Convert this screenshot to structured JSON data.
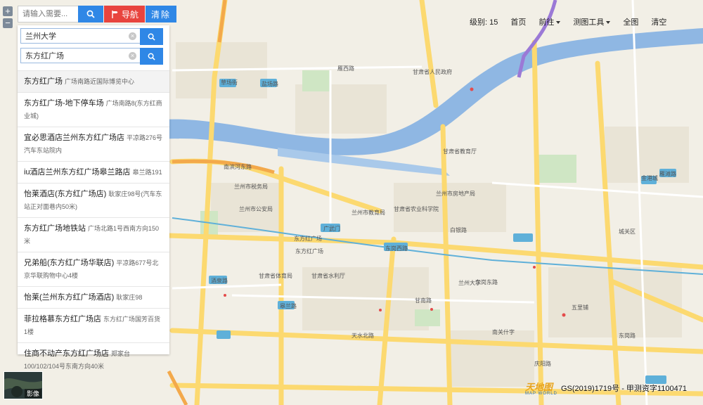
{
  "search": {
    "placeholder": "请输入需要...",
    "nav_label": "导航",
    "clear_label": "清除"
  },
  "route": {
    "from": "兰州大学",
    "to": "东方红广场",
    "clear_glyph": "×"
  },
  "results": [
    {
      "name": "东方红广场",
      "addr": "广场南路近国际博览中心"
    },
    {
      "name": "东方红广场-地下停车场",
      "addr": "广场南路8(东方红商业城)"
    },
    {
      "name": "宜必思酒店兰州东方红广场店",
      "addr": "平凉路276号汽车东站院内"
    },
    {
      "name": "iu酒店兰州东方红广场皋兰路店",
      "addr": "皋兰路191"
    },
    {
      "name": "怡莱酒店(东方红广场店)",
      "addr": "耿家庄98号(汽车东站正对面巷内50米)"
    },
    {
      "name": "东方红广场地铁站",
      "addr": "广场北路1号西南方向150米"
    },
    {
      "name": "兄弟船(东方红广场华联店)",
      "addr": "平凉路677号北京华联购物中心4楼"
    },
    {
      "name": "怡莱(兰州东方红广场酒店)",
      "addr": "耿家庄98"
    },
    {
      "name": "菲拉格慕东方红广场店",
      "addr": "东方红广场国芳百货1楼"
    },
    {
      "name": "住商不动产东方红广场店",
      "addr": "郑家台100/102/104号东南方向40米"
    }
  ],
  "toolbar": {
    "level": "级别: 15",
    "home": "首页",
    "forward": "前往",
    "measure": "测图工具",
    "fullscreen": "全图",
    "clear": "清空"
  },
  "zoom": {
    "in": "+",
    "out": "−"
  },
  "satellite_label": "影像",
  "logo": {
    "main": "天地图",
    "sub": "MAP WORLD"
  },
  "copyright": "GS(2019)1719号 - 甲测资字1100471",
  "map_labels": [
    "东方红广场",
    "兰州大学",
    "东岗西路",
    "南滨河东路",
    "广武门",
    "酒泉路",
    "东方红广场",
    "兰州市教育局",
    "甘肃省人民政府",
    "甘肃省教育厅",
    "五里铺",
    "东岗东路",
    "雁滩路",
    "兰州市房地产局",
    "兰州市税务局",
    "甘肃省农业科学院",
    "甘肃省水利厅",
    "甘肃省体育局",
    "皋兰路",
    "草场街",
    "盐场路",
    "城关区",
    "兰州市公安局",
    "白银路",
    "甘南路",
    "庆阳路",
    "东岗路",
    "天水北路",
    "雁西路",
    "南关什字",
    "金港城"
  ],
  "colors": {
    "accent_blue": "#2f87e6",
    "nav_red": "#e8443e",
    "river": "#8fb7e3",
    "road_yellow": "#fcd970"
  }
}
